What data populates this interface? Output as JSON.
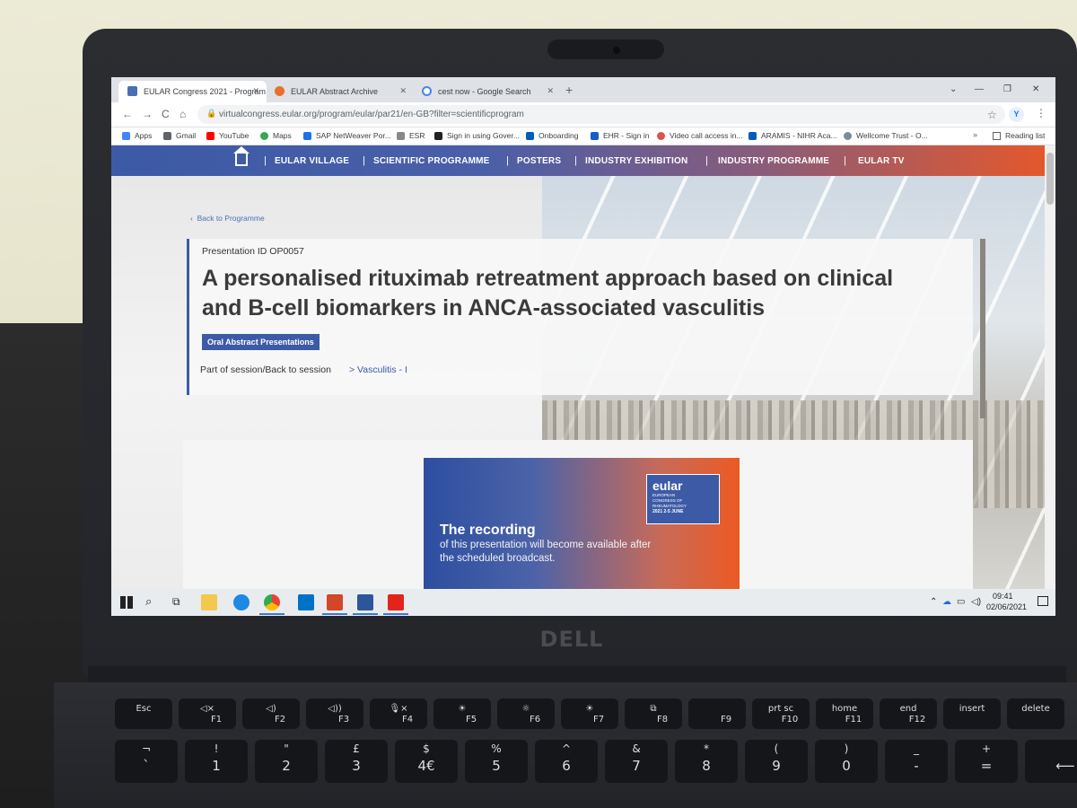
{
  "browser": {
    "tabs": [
      {
        "title": "EULAR Congress 2021 - Program",
        "active": true,
        "color": "#4a6fb5"
      },
      {
        "title": "EULAR Abstract Archive",
        "active": false,
        "color": "#e8702a"
      },
      {
        "title": "cest now - Google Search",
        "active": false,
        "color": "#4285f4"
      }
    ],
    "new_tab": "+",
    "nav": {
      "back": "←",
      "forward": "→",
      "reload": "C",
      "home": "⌂"
    },
    "url": "virtualcongress.eular.org/program/eular/par21/en-GB?filter=scientificprogram",
    "profile_initial": "Y",
    "bookmarks": [
      {
        "label": "Apps",
        "color": "#4285f4"
      },
      {
        "label": "Gmail",
        "color": "#5f6368"
      },
      {
        "label": "YouTube",
        "color": "#ff0000"
      },
      {
        "label": "Maps",
        "color": "#34a853"
      },
      {
        "label": "SAP NetWeaver Por...",
        "color": "#1a73e8"
      },
      {
        "label": "ESR",
        "color": "#888888"
      },
      {
        "label": "Sign in using Gover...",
        "color": "#222222"
      },
      {
        "label": "Onboarding",
        "color": "#005eb8"
      },
      {
        "label": "EHR - Sign in",
        "color": "#1a5bc4"
      },
      {
        "label": "Video call access in...",
        "color": "#d9534f"
      },
      {
        "label": "ARAMIS - NIHR Aca...",
        "color": "#005eb8"
      },
      {
        "label": "Wellcome Trust - O...",
        "color": "#7a8a99"
      }
    ],
    "bookmarks_more": "»",
    "reading_list": "Reading list"
  },
  "site_nav": {
    "items": [
      "EULAR VILLAGE",
      "SCIENTIFIC PROGRAMME",
      "POSTERS",
      "INDUSTRY EXHIBITION",
      "INDUSTRY PROGRAMME",
      "EULAR TV"
    ],
    "separator": "|"
  },
  "page": {
    "back_link": "Back to Programme",
    "presentation_id": "Presentation ID OP0057",
    "title_line1": "A personalised rituximab retreatment approach based on clinical",
    "title_line2": "and B-cell biomarkers in ANCA-associated vasculitis",
    "badge": "Oral Abstract Presentations",
    "session_label": "Part of session/Back to session",
    "session_link": "> Vasculitis - I"
  },
  "promo": {
    "logo_word": "eular",
    "logo_sub1": "EUROPEAN",
    "logo_sub2": "CONGRESS OF",
    "logo_sub3": "RHEUMATOLOGY",
    "logo_year": "2021 2-5 JUNE",
    "title": "The recording",
    "subtitle_line1": "of this presentation will become available after",
    "subtitle_line2": "the scheduled broadcast."
  },
  "taskbar": {
    "apps": [
      {
        "name": "file-explorer",
        "color": "#f2c94c"
      },
      {
        "name": "internet-explorer",
        "color": "#1e88e5"
      },
      {
        "name": "chrome",
        "color": "#ea4335"
      },
      {
        "name": "outlook",
        "color": "#0072c6"
      },
      {
        "name": "powerpoint",
        "color": "#d24726"
      },
      {
        "name": "word",
        "color": "#2b579a"
      },
      {
        "name": "acrobat",
        "color": "#e1251b"
      }
    ],
    "time": "09:41",
    "date": "02/06/2021"
  },
  "laptop": {
    "brand": "DELL"
  },
  "keyboard": {
    "fn_row": [
      {
        "main": "Esc",
        "sub": ""
      },
      {
        "main": "◁×",
        "sub": "F1"
      },
      {
        "main": "◁)",
        "sub": "F2"
      },
      {
        "main": "◁))",
        "sub": "F3"
      },
      {
        "main": "🎙×",
        "sub": "F4"
      },
      {
        "main": "☀",
        "sub": "F5"
      },
      {
        "main": "☼",
        "sub": "F6"
      },
      {
        "main": "☀",
        "sub": "F7"
      },
      {
        "main": "⧉",
        "sub": "F8"
      },
      {
        "main": "",
        "sub": "F9"
      },
      {
        "main": "prt sc",
        "sub": "F10"
      },
      {
        "main": "home",
        "sub": "F11"
      },
      {
        "main": "end",
        "sub": "F12"
      },
      {
        "main": "insert",
        "sub": ""
      },
      {
        "main": "delete",
        "sub": ""
      }
    ],
    "num_row": [
      {
        "top": "¬",
        "bottom": "`"
      },
      {
        "top": "!",
        "bottom": "1"
      },
      {
        "top": "\"",
        "bottom": "2"
      },
      {
        "top": "£",
        "bottom": "3"
      },
      {
        "top": "$",
        "bottom": "4€"
      },
      {
        "top": "%",
        "bottom": "5"
      },
      {
        "top": "^",
        "bottom": "6"
      },
      {
        "top": "&",
        "bottom": "7"
      },
      {
        "top": "*",
        "bottom": "8"
      },
      {
        "top": "(",
        "bottom": "9"
      },
      {
        "top": ")",
        "bottom": "0"
      },
      {
        "top": "_",
        "bottom": "-"
      },
      {
        "top": "+",
        "bottom": "="
      },
      {
        "top": "",
        "bottom": "⟵"
      }
    ]
  }
}
